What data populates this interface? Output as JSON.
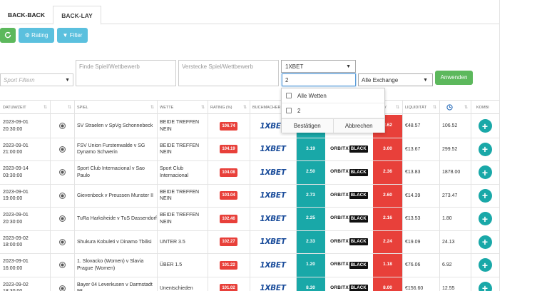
{
  "tabs": [
    "BACK-BACK",
    "BACK-LAY"
  ],
  "toolbar": {
    "refresh_icon": "refresh-icon",
    "rating_label": "Rating",
    "filter_label": "Filter"
  },
  "filters": {
    "sport_placeholder": "Sport Filtern",
    "find_placeholder": "Finde Spiel/Wettbewerb",
    "hide_placeholder": "Verstecke Spiel/Wettbewerb",
    "bookmaker_selected": "1XBET",
    "search_value": "2",
    "exchange_selected": "Alle Exchange",
    "apply_label": "Anwenden"
  },
  "dropdown": {
    "items": [
      "Alle Wetten",
      "2"
    ],
    "confirm_label": "Bestätigen",
    "cancel_label": "Abbrechen"
  },
  "columns": [
    "DATUM/ZEIT",
    "SPIEL",
    "WETTE",
    "RATING (%)",
    "BUCHMACHER",
    "LIQUIDITÄT",
    "KOMBI"
  ],
  "rows": [
    {
      "date": "2023-09-01",
      "time": "20:30:00",
      "game": "SV Straelen v SpVg Schonnebeck",
      "bet": "BEIDE TREFFEN NEIN",
      "rating": "106.74",
      "bookmaker": "1XBET",
      "back": "",
      "exchange": "ORBITX BLACK",
      "lay": "2.62",
      "liquidity": "€48.57",
      "time_val": "106.52"
    },
    {
      "date": "2023-09-01",
      "time": "21:00:00",
      "game": "FSV Union Furstenwalde v SG Dynamo Schwerin",
      "bet": "BEIDE TREFFEN NEIN",
      "rating": "104.19",
      "bookmaker": "1XBET",
      "back": "3.19",
      "exchange": "ORBITX BLACK",
      "lay": "3.00",
      "liquidity": "€13.67",
      "time_val": "299.52"
    },
    {
      "date": "2023-09-14",
      "time": "03:30:00",
      "game": "Sport Club Internacional v Sao Paulo",
      "bet": "Sport Club Internacional",
      "rating": "104.08",
      "bookmaker": "1XBET",
      "back": "2.50",
      "exchange": "ORBITX BLACK",
      "lay": "2.36",
      "liquidity": "€13.83",
      "time_val": "1878.00"
    },
    {
      "date": "2023-09-01",
      "time": "19:00:00",
      "game": "Gievenbeck v Preussen Munster II",
      "bet": "BEIDE TREFFEN NEIN",
      "rating": "103.04",
      "bookmaker": "1XBET",
      "back": "2.73",
      "exchange": "ORBITX BLACK",
      "lay": "2.60",
      "liquidity": "€14.39",
      "time_val": "273.47"
    },
    {
      "date": "2023-09-01",
      "time": "20:30:00",
      "game": "TuRa Harksheide v TuS Dassendorf",
      "bet": "BEIDE TREFFEN NEIN",
      "rating": "102.46",
      "bookmaker": "1XBET",
      "back": "2.25",
      "exchange": "ORBITX BLACK",
      "lay": "2.16",
      "liquidity": "€13.53",
      "time_val": "1.80"
    },
    {
      "date": "2023-09-02",
      "time": "18:00:00",
      "game": "Shukura Kobuleti v Dinamo Tbilisi",
      "bet": "UNTER 3.5",
      "rating": "102.27",
      "bookmaker": "1XBET",
      "back": "2.33",
      "exchange": "ORBITX BLACK",
      "lay": "2.24",
      "liquidity": "€19.09",
      "time_val": "24.13"
    },
    {
      "date": "2023-09-01",
      "time": "16:00:00",
      "game": "1. Slovacko (Women) v Slavia Prague (Women)",
      "bet": "ÜBER 1.5",
      "rating": "101.22",
      "bookmaker": "1XBET",
      "back": "1.20",
      "exchange": "ORBITX BLACK",
      "lay": "1.18",
      "liquidity": "€76.06",
      "time_val": "6.92"
    },
    {
      "date": "2023-09-02",
      "time": "18:30:00",
      "game": "Bayer 04 Leverkusen v Darmstadt 98",
      "bet": "Unentschieden",
      "rating": "101.02",
      "bookmaker": "1XBET",
      "back": "8.30",
      "exchange": "ORBITX BLACK",
      "lay": "8.00",
      "liquidity": "€156.60",
      "time_val": "12.55"
    }
  ],
  "colors": {
    "green": "#5cb85c",
    "info": "#5bc0de",
    "back": "#19a8a8",
    "lay": "#e8403a"
  }
}
